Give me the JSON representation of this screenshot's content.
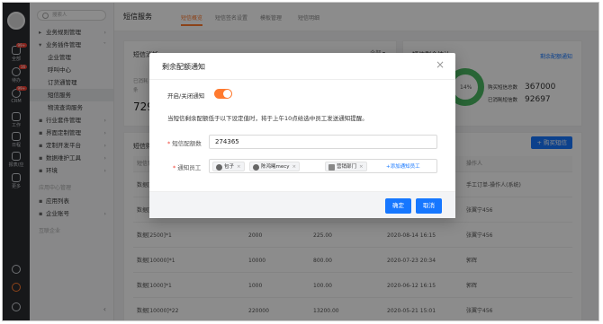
{
  "rail": {
    "items": [
      {
        "label": "全部",
        "icon": "grid-icon",
        "badge": "99+"
      },
      {
        "label": "待办",
        "icon": "check-circle-icon",
        "badge": "16"
      },
      {
        "label": "CRM",
        "icon": "crm-icon",
        "badge": "99+"
      },
      {
        "label": "工作",
        "icon": "briefcase-icon",
        "badge": ""
      },
      {
        "label": "日程",
        "icon": "calendar-icon",
        "badge": ""
      },
      {
        "label": "报表/应",
        "icon": "chart-icon",
        "badge": ""
      },
      {
        "label": "更多",
        "icon": "apps-icon",
        "badge": ""
      }
    ],
    "help_icon": "help-icon",
    "settings_icon": "settings-icon",
    "user_icon": "user-icon"
  },
  "sidebar": {
    "search_placeholder": "搜索人",
    "items": [
      {
        "label": "业务规则管理",
        "type": "parent",
        "arrow": "›"
      },
      {
        "label": "业务插件管理",
        "type": "parent-open",
        "arrow": "˅"
      },
      {
        "label": "企业管理",
        "type": "sub"
      },
      {
        "label": "呼叫中心",
        "type": "sub"
      },
      {
        "label": "订货通管理",
        "type": "sub"
      },
      {
        "label": "短信服务",
        "type": "sub",
        "active": true
      },
      {
        "label": "物流查询服务",
        "type": "sub"
      },
      {
        "label": "行业套件管理",
        "type": "parent",
        "arrow": "›"
      },
      {
        "label": "界面定制管理",
        "type": "parent",
        "arrow": "›"
      },
      {
        "label": "定制开发平台",
        "type": "parent",
        "arrow": "›"
      },
      {
        "label": "数据维护工具",
        "type": "parent",
        "arrow": "›"
      },
      {
        "label": "环境",
        "type": "parent",
        "arrow": "›"
      }
    ],
    "group2_label": "应用中心管理",
    "group2_items": [
      {
        "label": "应用列表"
      },
      {
        "label": "企业账号",
        "arrow": "›"
      }
    ],
    "group3_label": "互联企业",
    "collapse": "‹"
  },
  "topbar": {
    "title": "短信服务",
    "tabs": [
      "短信概览",
      "短信签名设置",
      "模板管理",
      "短信明细"
    ]
  },
  "stats": {
    "card1_title": "短信消耗",
    "card1_select": "全部 ▾",
    "card1_label1": "已消耗",
    "card1_label2": "条",
    "card1_value": "7296",
    "card2_title": "短信剩余统计",
    "card2_link": "剩余配额通知",
    "ring_pct": "14%",
    "purchased_label": "购买短信总数",
    "purchased_value": "367000",
    "used_label": "已消耗短信数",
    "used_value": "92697"
  },
  "table": {
    "title": "短信购买记录",
    "buy_button": "+ 购买短信",
    "headers": [
      "短信包",
      "",
      "",
      "",
      "",
      "操作人"
    ],
    "rows": [
      {
        "name": "数据[10000]*1",
        "count": "",
        "price": "",
        "date": "",
        "operator": "手工订单-操作人(系统)"
      },
      {
        "name": "数据[10000]*1",
        "count": "",
        "price": "",
        "date": "",
        "operator": "张翼宁456"
      },
      {
        "name": "数据[2500]*1",
        "count": "2000",
        "price": "225.00",
        "date": "2020-08-14 16:15",
        "operator": "张翼宁456"
      },
      {
        "name": "数据[10000]*1",
        "count": "10000",
        "price": "800.00",
        "date": "2020-07-23 20:34",
        "operator": "郭辉"
      },
      {
        "name": "数据[1000]*1",
        "count": "1000",
        "price": "100.00",
        "date": "2020-06-12 16:15",
        "operator": "郭辉"
      },
      {
        "name": "数据[10000]*22",
        "count": "220000",
        "price": "13200.00",
        "date": "2020-05-21 15:01",
        "operator": "张翼宁456"
      }
    ]
  },
  "modal": {
    "title": "剩余配额通知",
    "toggle_label": "开启/关闭通知",
    "toggle_on": true,
    "description": "当短信剩余配额低于以下设定值时，将于上午10点给选中员工发送通知提醒。",
    "quota_label": "短信配额数",
    "quota_value": "274365",
    "staff_label": "通知员工",
    "tags": [
      {
        "label": "包子",
        "icon": "person-icon"
      },
      {
        "label": "陈鸿曦mecy",
        "icon": "person-icon"
      },
      {
        "label": "营销部门",
        "icon": "org-icon"
      }
    ],
    "add_staff": "+添加通知员工",
    "confirm": "确定",
    "cancel": "取消"
  }
}
